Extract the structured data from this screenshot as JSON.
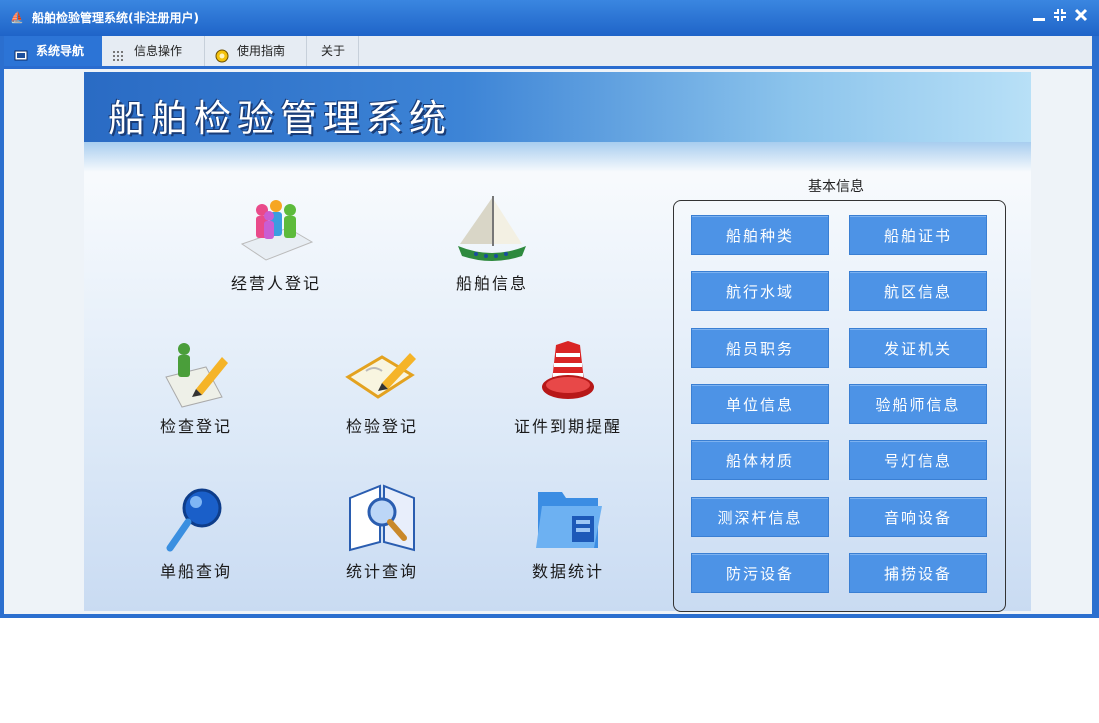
{
  "window": {
    "title": "船舶检验管理系统(非注册用户)",
    "app_icon": "ship-logo-icon"
  },
  "menu": {
    "tabs": [
      {
        "label": "系统导航",
        "icon": "monitor-icon"
      },
      {
        "label": "信息操作",
        "icon": "grid-icon"
      },
      {
        "label": "使用指南",
        "icon": "help-circle-icon"
      },
      {
        "label": "关于"
      }
    ]
  },
  "banner": {
    "title": "船舶检验管理系统"
  },
  "features": [
    {
      "label": "经营人登记",
      "icon": "people-icon"
    },
    {
      "label": "船舶信息",
      "icon": "sailboat-icon"
    },
    {
      "label": "检查登记",
      "icon": "pencil-person-icon"
    },
    {
      "label": "检验登记",
      "icon": "notebook-pencil-icon"
    },
    {
      "label": "证件到期提醒",
      "icon": "alarm-bell-icon"
    },
    {
      "label": "单船查询",
      "icon": "magnifier-icon"
    },
    {
      "label": "统计查询",
      "icon": "book-search-icon"
    },
    {
      "label": "数据统计",
      "icon": "folder-document-icon"
    }
  ],
  "basic_info": {
    "title": "基本信息",
    "buttons": [
      "船舶种类",
      "船舶证书",
      "航行水域",
      "航区信息",
      "船员职务",
      "发证机关",
      "单位信息",
      "验船师信息",
      "船体材质",
      "号灯信息",
      "测深杆信息",
      "音响设备",
      "防污设备",
      "捕捞设备"
    ]
  },
  "colors": {
    "accent": "#2c74d6",
    "button": "#4d93e6",
    "titlebar": "#1f64c8"
  }
}
